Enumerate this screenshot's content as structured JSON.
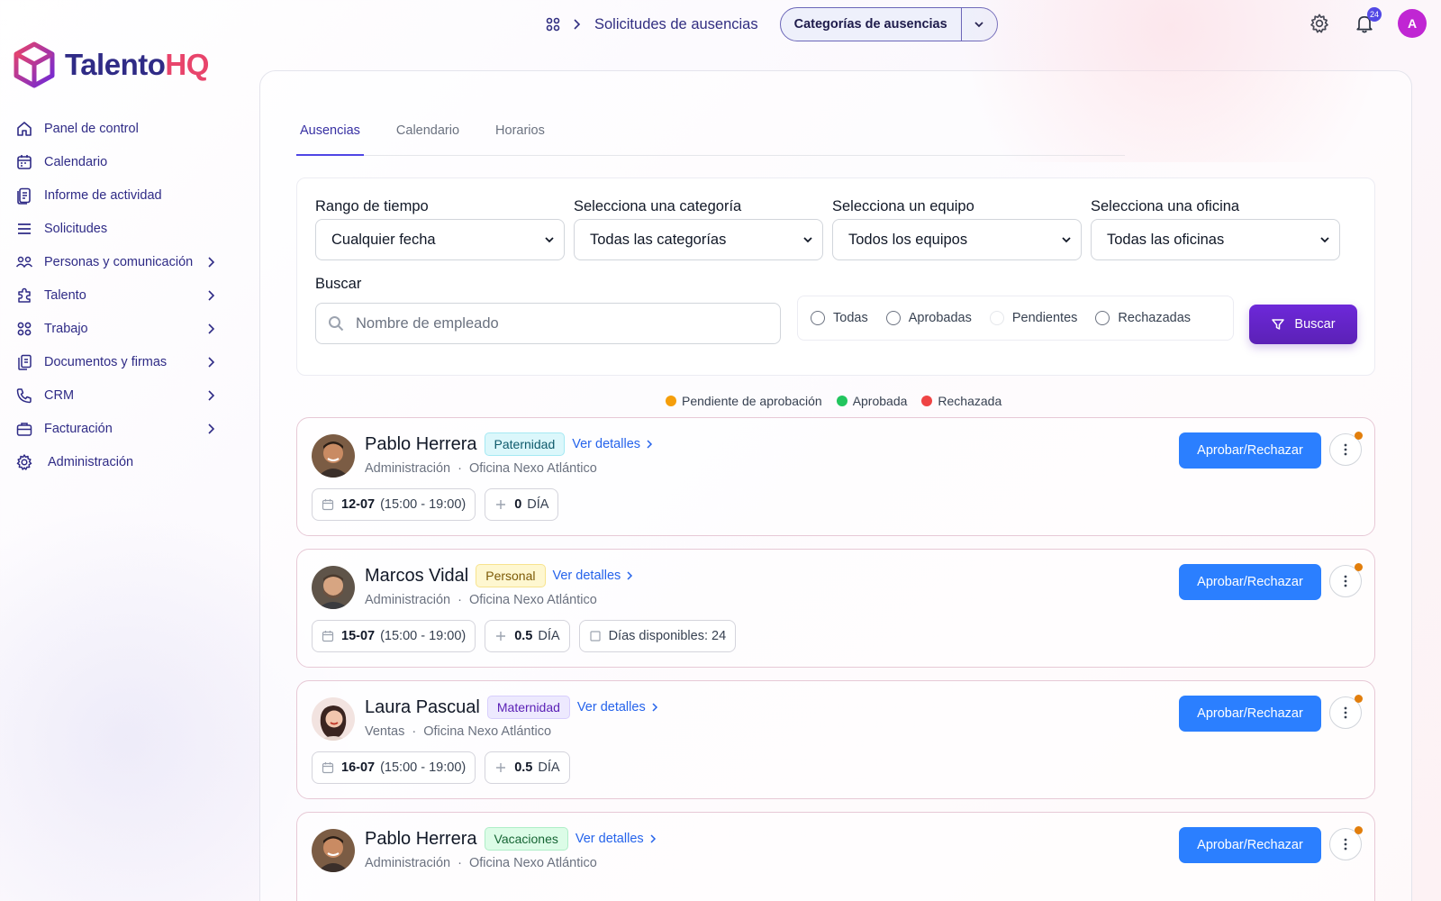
{
  "brand": {
    "part1": "Talento",
    "part2": "HQ"
  },
  "topbar": {
    "breadcrumb": "Solicitudes de ausencias",
    "category_button": "Categorías de ausencias",
    "notifications_count": "24",
    "avatar_initial": "A"
  },
  "sidebar": {
    "items": [
      {
        "label": "Panel de control",
        "icon": "home-icon"
      },
      {
        "label": "Calendario",
        "icon": "calendar-icon"
      },
      {
        "label": "Informe de actividad",
        "icon": "report-icon"
      },
      {
        "label": "Solicitudes",
        "icon": "list-icon"
      },
      {
        "label": "Personas y comunicación",
        "icon": "people-icon",
        "expandable": true
      },
      {
        "label": "Talento",
        "icon": "puzzle-icon",
        "expandable": true
      },
      {
        "label": "Trabajo",
        "icon": "apps-icon",
        "expandable": true
      },
      {
        "label": "Documentos y firmas",
        "icon": "documents-icon",
        "expandable": true
      },
      {
        "label": "CRM",
        "icon": "phone-icon",
        "expandable": true
      },
      {
        "label": "Facturación",
        "icon": "briefcase-icon",
        "expandable": true
      },
      {
        "label": "Administración",
        "icon": "gear-icon"
      }
    ]
  },
  "tabs": [
    {
      "label": "Ausencias",
      "active": true
    },
    {
      "label": "Calendario",
      "active": false
    },
    {
      "label": "Horarios",
      "active": false
    }
  ],
  "filters": {
    "time_range": {
      "label": "Rango de tiempo",
      "value": "Cualquier fecha"
    },
    "category": {
      "label": "Selecciona una categoría",
      "value": "Todas las categorías"
    },
    "team": {
      "label": "Selecciona un equipo",
      "value": "Todos los equipos"
    },
    "office": {
      "label": "Selecciona una oficina",
      "value": "Todas las oficinas"
    },
    "search_label": "Buscar",
    "search_placeholder": "Nombre de empleado",
    "status_options": [
      "Todas",
      "Aprobadas",
      "Pendientes",
      "Rechazadas"
    ],
    "search_button": "Buscar"
  },
  "legend": [
    {
      "label": "Pendiente de aprobación",
      "color": "#f59e0b"
    },
    {
      "label": "Aprobada",
      "color": "#22c55e"
    },
    {
      "label": "Rechazada",
      "color": "#ef4444"
    }
  ],
  "requests": [
    {
      "name": "Pablo Herrera",
      "type": "Paternidad",
      "details_label": "Ver detalles",
      "department": "Administración",
      "office": "Oficina Nexo Atlántico",
      "date": "12-07",
      "time": "(15:00 - 19:00)",
      "days": "0",
      "unit": "DÍA",
      "available": "",
      "action": "Aprobar/Rechazar"
    },
    {
      "name": "Marcos Vidal",
      "type": "Personal",
      "details_label": "Ver detalles",
      "department": "Administración",
      "office": "Oficina Nexo Atlántico",
      "date": "15-07",
      "time": "(15:00 - 19:00)",
      "days": "0.5",
      "unit": "DÍA",
      "available": "Días disponibles: 24",
      "action": "Aprobar/Rechazar"
    },
    {
      "name": "Laura Pascual",
      "type": "Maternidad",
      "details_label": "Ver detalles",
      "department": "Ventas",
      "office": "Oficina Nexo Atlántico",
      "date": "16-07",
      "time": "(15:00 - 19:00)",
      "days": "0.5",
      "unit": "DÍA",
      "available": "",
      "action": "Aprobar/Rechazar"
    },
    {
      "name": "Pablo Herrera",
      "type": "Vacaciones",
      "details_label": "Ver detalles",
      "department": "Administración",
      "office": "Oficina Nexo Atlántico",
      "date": "",
      "time": "",
      "days": "",
      "unit": "",
      "available": "",
      "action": "Aprobar/Rechazar"
    }
  ]
}
